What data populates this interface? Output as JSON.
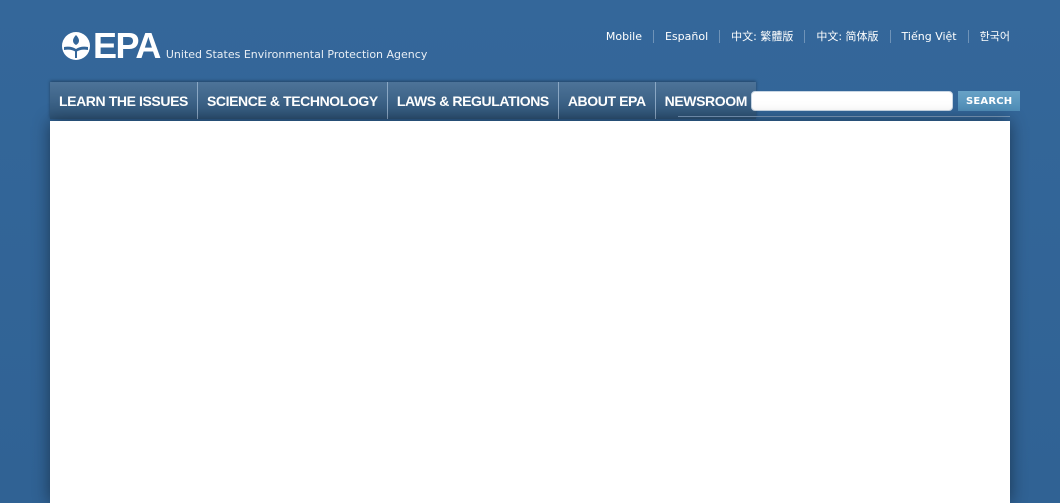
{
  "header": {
    "logo_text": "EPA",
    "agency_name": "United States Environmental Protection Agency"
  },
  "languages": [
    "Mobile",
    "Español",
    "中文: 繁體版",
    "中文: 简体版",
    "Tiếng Việt",
    "한국어"
  ],
  "nav": {
    "items": [
      "LEARN THE ISSUES",
      "SCIENCE & TECHNOLOGY",
      "LAWS & REGULATIONS",
      "ABOUT EPA",
      "NEWSROOM"
    ]
  },
  "search": {
    "placeholder": "",
    "button_label": "SEARCH"
  },
  "colors": {
    "background": "#336699",
    "nav_background": "#3b6186",
    "search_button": "#5a97c0",
    "content_background": "#ffffff"
  }
}
